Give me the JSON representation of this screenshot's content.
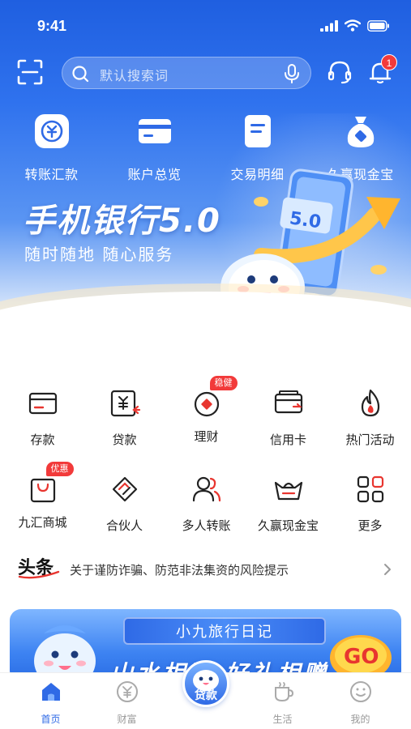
{
  "status": {
    "time": "9:41"
  },
  "search": {
    "placeholder": "默认搜索词"
  },
  "notifications": {
    "count": "1"
  },
  "quick_actions": [
    {
      "label": "转账汇款",
      "icon": "transfer-icon"
    },
    {
      "label": "账户总览",
      "icon": "card-icon"
    },
    {
      "label": "交易明细",
      "icon": "document-icon"
    },
    {
      "label": "久赢现金宝",
      "icon": "money-bag-icon"
    }
  ],
  "banner": {
    "title": "手机银行5.0",
    "subtitle": "随时随地 随心服务",
    "badge": "5.0"
  },
  "menu": [
    {
      "label": "存款",
      "icon": "deposit-icon"
    },
    {
      "label": "贷款",
      "icon": "loan-icon"
    },
    {
      "label": "理财",
      "icon": "wealth-icon",
      "tag": "稳健"
    },
    {
      "label": "信用卡",
      "icon": "credit-card-icon"
    },
    {
      "label": "热门活动",
      "icon": "flame-icon"
    },
    {
      "label": "九汇商城",
      "icon": "shopping-bag-icon",
      "tag": "优惠"
    },
    {
      "label": "合伙人",
      "icon": "handshake-icon"
    },
    {
      "label": "多人转账",
      "icon": "people-icon"
    },
    {
      "label": "久赢现金宝",
      "icon": "ingot-icon"
    },
    {
      "label": "更多",
      "icon": "grid-icon"
    }
  ],
  "news": {
    "logo": "头条",
    "text": "关于谨防诈骗、防范非法集资的风险提示"
  },
  "promo": {
    "ribbon": "小九旅行日记",
    "slogan": "山水相随 好礼相赠",
    "go": "GO"
  },
  "tabs": [
    {
      "label": "首页",
      "icon": "home-icon",
      "active": true
    },
    {
      "label": "财富",
      "icon": "yen-coin-icon"
    },
    {
      "label": "贷款",
      "icon": "mascot-icon"
    },
    {
      "label": "生活",
      "icon": "cup-icon"
    },
    {
      "label": "我的",
      "icon": "smile-icon"
    }
  ],
  "colors": {
    "primary": "#2f6ae6",
    "accent": "#f23a3a"
  }
}
